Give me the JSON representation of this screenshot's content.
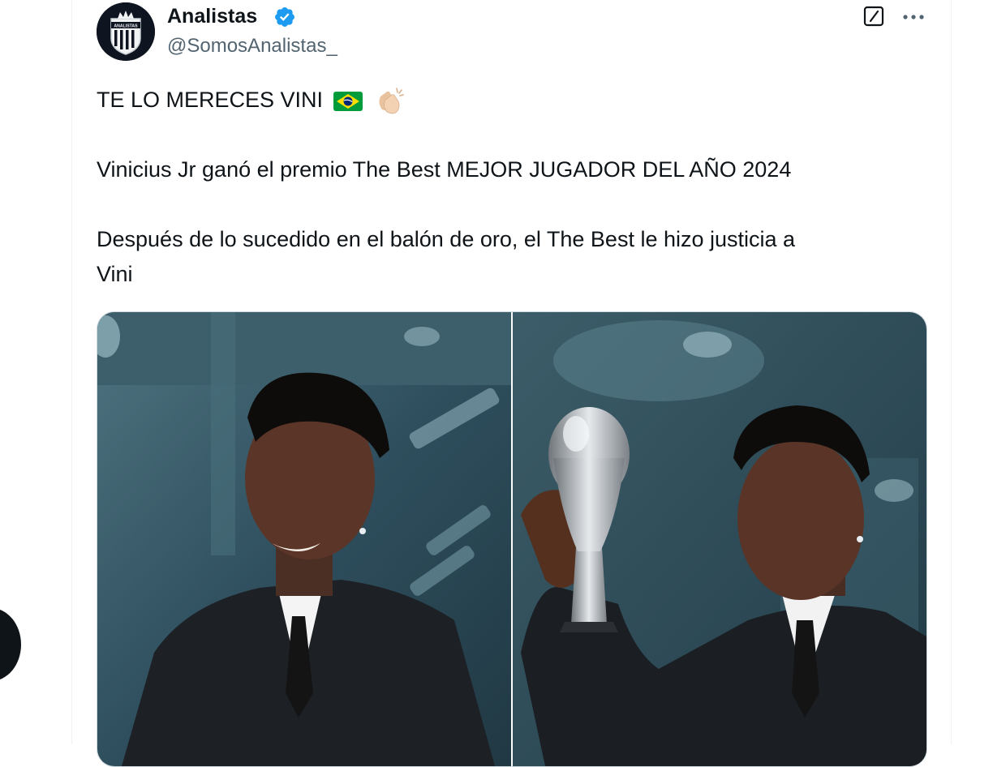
{
  "tweet": {
    "author": {
      "name": "Analistas",
      "handle": "@SomosAnalistas_",
      "avatar_text": "ANALISTAS",
      "verified": true
    },
    "text_lines": [
      "TE LO MERECES VINI",
      "Vinicius Jr ganó el premio The Best  MEJOR JUGADOR DEL AÑO 2024",
      "Después de lo sucedido en el balón de oro, el The Best le hizo justicia a",
      "Vini"
    ],
    "emojis": [
      "brazil-flag",
      "clapping-hands"
    ],
    "media": [
      {
        "subject": "player-smiling"
      },
      {
        "subject": "player-holding-trophy"
      }
    ]
  },
  "colors": {
    "text": "#0f1419",
    "secondary": "#536471",
    "verified": "#1d9bf0",
    "border": "#cfd9de",
    "photo_bg": "#2f4f5e"
  },
  "icons": [
    "grok-icon",
    "more-icon",
    "verified-icon",
    "brazil-flag-icon",
    "clap-icon"
  ]
}
